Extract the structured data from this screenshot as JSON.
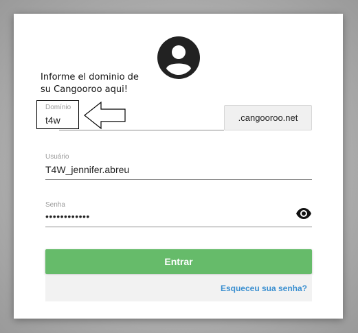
{
  "note": {
    "line1": "Informe el dominio de",
    "line2": "su Cangooroo aqui!"
  },
  "domain_field": {
    "label": "Domínio",
    "value": "t4w"
  },
  "domain_suffix": ".cangooroo.net",
  "user_field": {
    "label": "Usuário",
    "value": "T4W_jennifer.abreu"
  },
  "password_field": {
    "label": "Senha",
    "value": "••••••••••••"
  },
  "enter_button": "Entrar",
  "forgot_link": "Esqueceu sua senha?",
  "icons": {
    "avatar": "account-circle-icon",
    "visibility": "eye-icon",
    "annotation": "arrow-left-icon"
  },
  "colors": {
    "primary_button": "#66bb6a",
    "link": "#3a8fd0"
  }
}
